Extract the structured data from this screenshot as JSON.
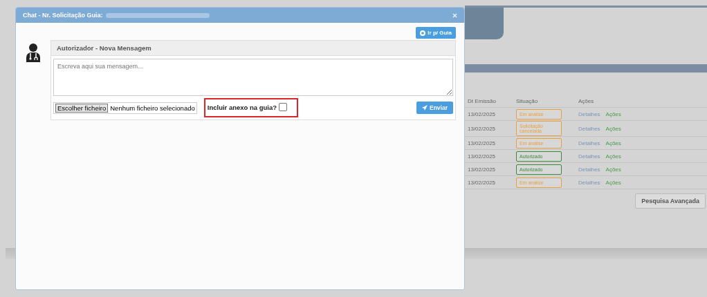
{
  "modal": {
    "title": "Chat - Nr. Solicitação Guia:",
    "go_button": "Ir p/ Guia",
    "message_panel": {
      "heading": "Autorizador - Nova Mensagem",
      "placeholder": "Escreva aqui sua mensagem...",
      "file_button": "Escolher ficheiro",
      "file_status": "Nenhum ficheiro selecionado",
      "attach_label": "Incluir anexo na guia?",
      "attach_checked": false,
      "send_button": "Enviar"
    }
  },
  "background_table": {
    "columns": [
      "Dt Emissão",
      "Situação",
      "Ações"
    ],
    "rows": [
      {
        "date": "13/02/2025",
        "status": "Em análise",
        "color": "#e8a040",
        "details": "Detalhes",
        "actions": "Ações"
      },
      {
        "date": "13/02/2025",
        "status": "Solicitação cancelada",
        "color": "#e8a040",
        "details": "Detalhes",
        "actions": "Ações"
      },
      {
        "date": "13/02/2025",
        "status": "Em análise",
        "color": "#e8a040",
        "details": "Detalhes",
        "actions": "Ações"
      },
      {
        "date": "13/02/2025",
        "status": "Autorizado",
        "color": "#3a8a3a",
        "details": "Detalhes",
        "actions": "Ações"
      },
      {
        "date": "13/02/2025",
        "status": "Autorizado",
        "color": "#3a8a3a",
        "details": "Detalhes",
        "actions": "Ações"
      },
      {
        "date": "13/02/2025",
        "status": "Em análise",
        "color": "#e8a040",
        "details": "Detalhes",
        "actions": "Ações"
      }
    ],
    "search_button": "Pesquisa Avançada"
  }
}
